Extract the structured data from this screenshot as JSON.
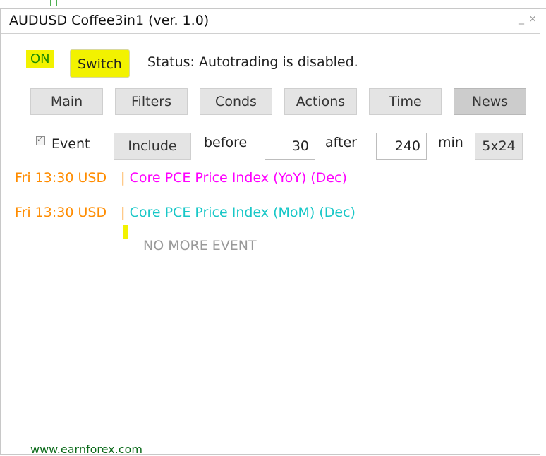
{
  "window": {
    "title": "AUDUSD Coffee3in1 (ver. 1.0)",
    "minimize_glyph": "_",
    "close_glyph": "×"
  },
  "controls": {
    "on_label": "ON",
    "switch_label": "Switch",
    "status_text": "Status: Autotrading is disabled."
  },
  "tabs": [
    {
      "label": "Main",
      "active": false
    },
    {
      "label": "Filters",
      "active": false
    },
    {
      "label": "Conds",
      "active": false
    },
    {
      "label": "Actions",
      "active": false
    },
    {
      "label": "Time",
      "active": false
    },
    {
      "label": "News",
      "active": true
    }
  ],
  "filter": {
    "checked": true,
    "event_label": "Event",
    "include_label": "Include",
    "before_label": "before",
    "before_value": "30",
    "after_label": "after",
    "after_value": "240",
    "min_label": "min",
    "grid_label": "5x24"
  },
  "events": [
    {
      "time": "Fri 13:30 USD",
      "separator": "|",
      "name": "Core PCE Price Index (YoY) (Dec)",
      "color": "#ff00ff"
    },
    {
      "time": "Fri 13:30 USD",
      "separator": "|",
      "name": "Core PCE Price Index (MoM) (Dec)",
      "color": "#18c7c7"
    }
  ],
  "empty_state": "NO MORE EVENT",
  "footer": {
    "link": "www.earnforex.com"
  },
  "colors": {
    "highlight": "#f2f200",
    "on_text": "#1f8d00",
    "event_time": "#ff8c00",
    "footer_text": "#0b6a1a"
  }
}
